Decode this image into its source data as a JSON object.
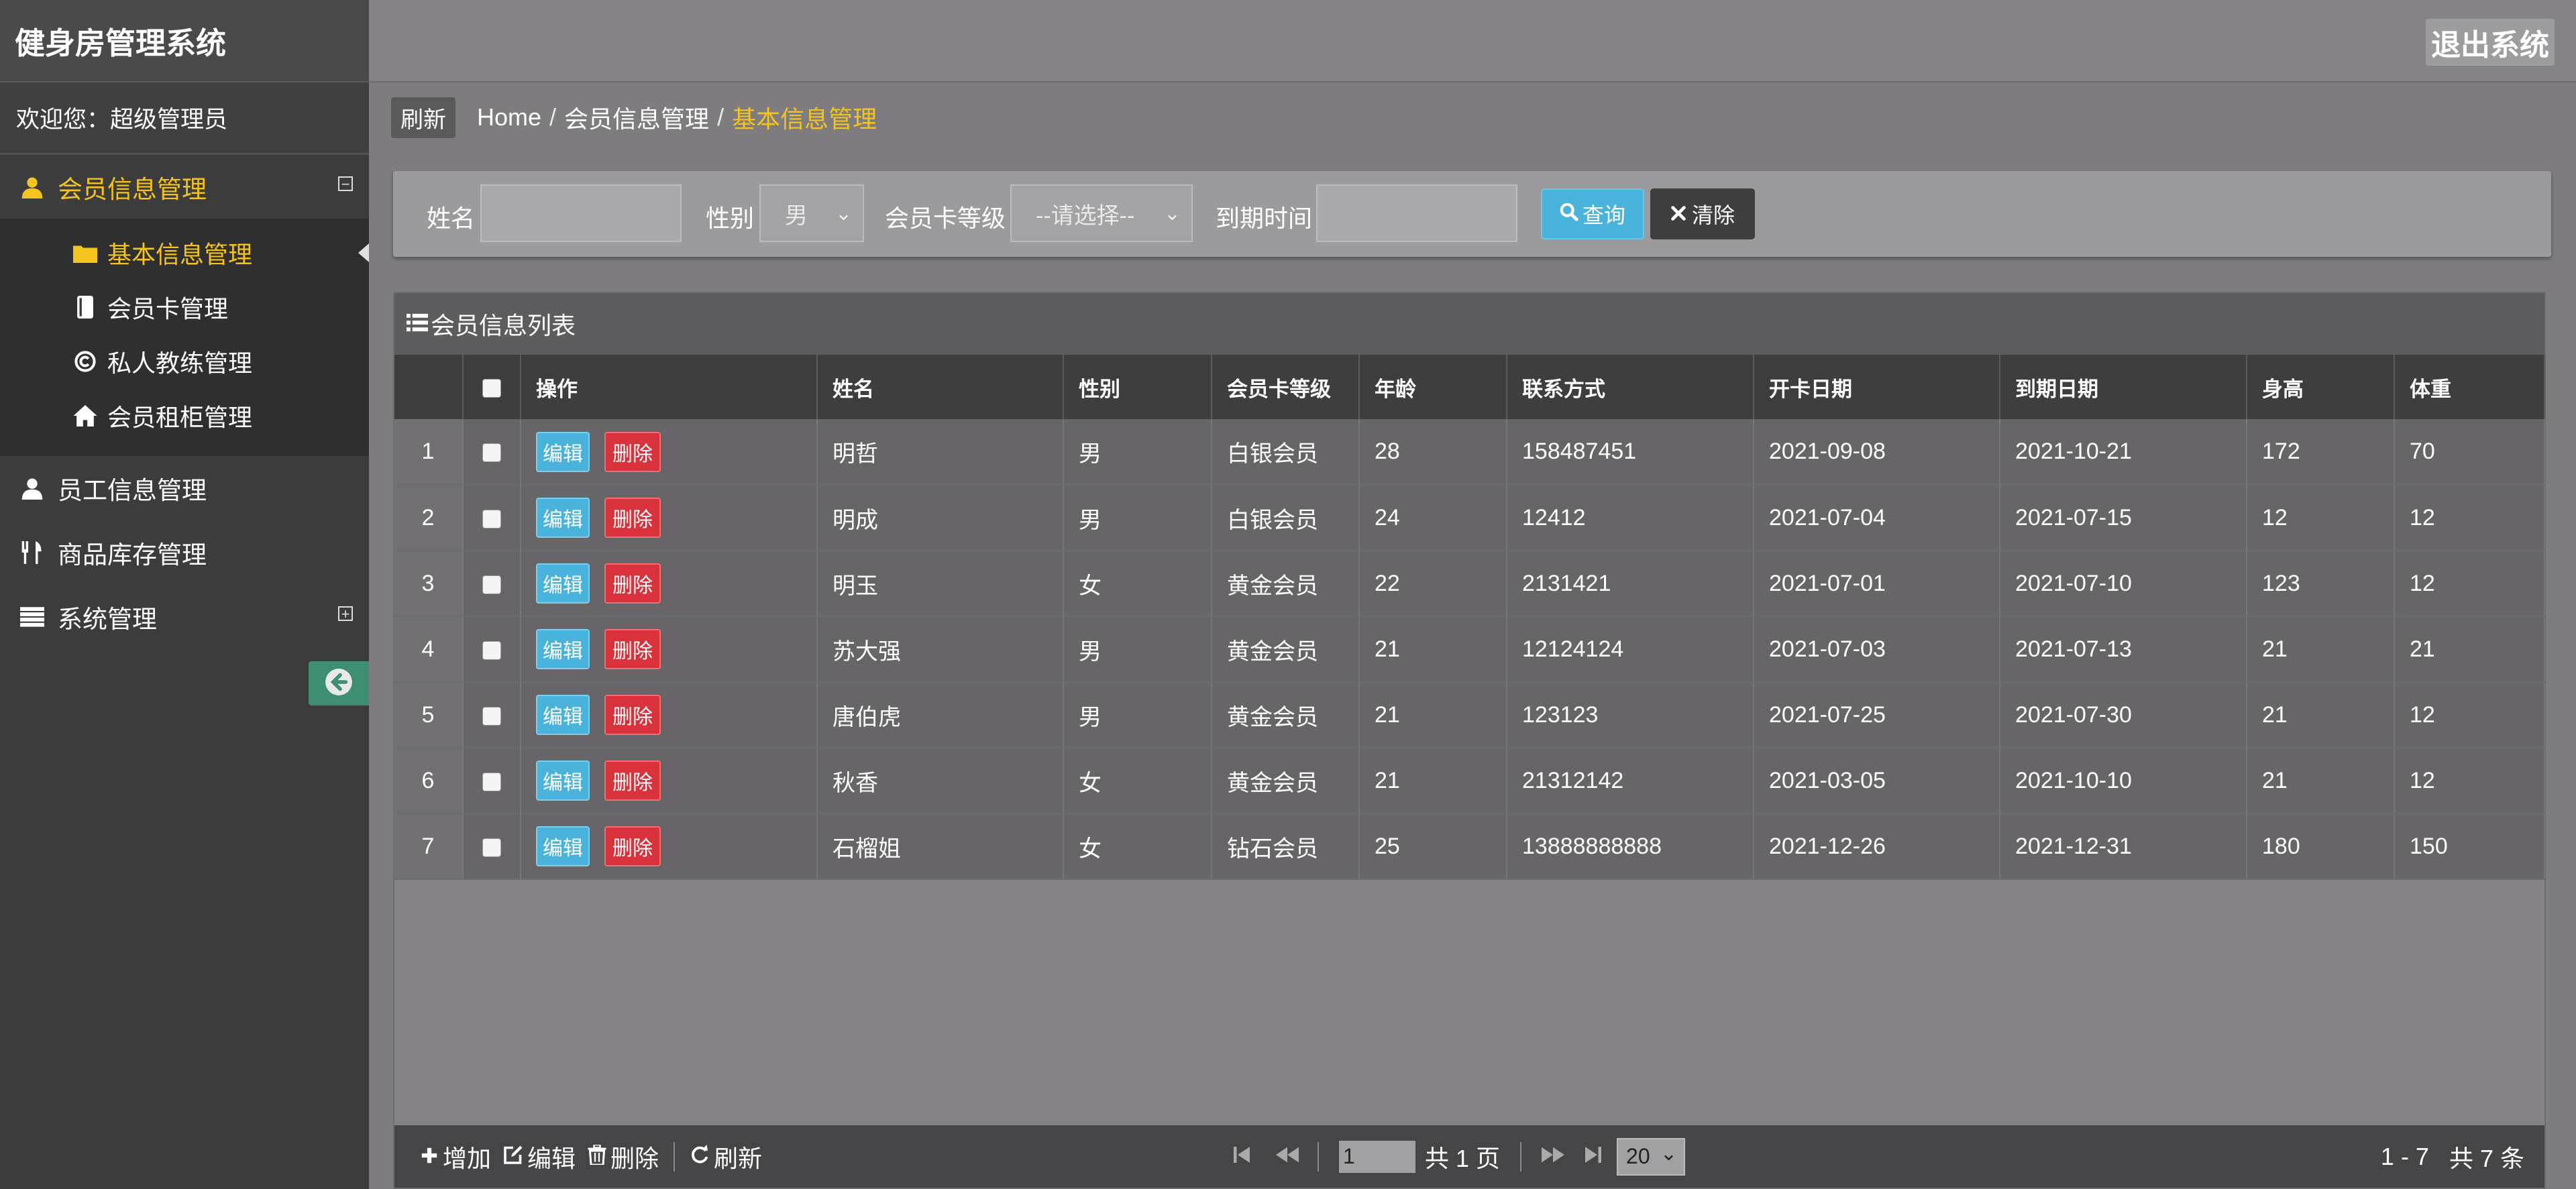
{
  "app": {
    "title": "健身房管理系统",
    "welcome": "欢迎您：超级管理员",
    "logout_label": "退出系统"
  },
  "sidebar": {
    "groups": [
      {
        "label": "会员信息管理",
        "icon": "user-icon",
        "expanded": true,
        "items": [
          {
            "label": "基本信息管理",
            "icon": "folder-icon",
            "active": true
          },
          {
            "label": "会员卡管理",
            "icon": "book-icon"
          },
          {
            "label": "私人教练管理",
            "icon": "copyright-icon"
          },
          {
            "label": "会员租柜管理",
            "icon": "home-icon"
          }
        ]
      },
      {
        "label": "员工信息管理",
        "icon": "user-icon"
      },
      {
        "label": "商品库存管理",
        "icon": "cutlery-icon"
      },
      {
        "label": "系统管理",
        "icon": "list-icon"
      }
    ]
  },
  "breadcrumb": {
    "refresh_label": "刷新",
    "items": [
      "Home",
      "会员信息管理",
      "基本信息管理"
    ],
    "sep": "/"
  },
  "search": {
    "name_label": "姓名",
    "name_value": "",
    "gender_label": "性别",
    "gender_value": "男",
    "level_label": "会员卡等级",
    "level_value": "--请选择--",
    "expire_label": "到期时间",
    "expire_value": "",
    "query_label": "查询",
    "clear_label": "清除"
  },
  "list": {
    "title": "会员信息列表",
    "headers": {
      "op": "操作",
      "name": "姓名",
      "gender": "性别",
      "level": "会员卡等级",
      "age": "年龄",
      "phone": "联系方式",
      "start": "开卡日期",
      "end": "到期日期",
      "height": "身高",
      "weight": "体重"
    },
    "edit_label": "编辑",
    "delete_label": "删除",
    "rows": [
      {
        "no": "1",
        "name": "明哲",
        "gender": "男",
        "level": "白银会员",
        "age": "28",
        "phone": "158487451",
        "start": "2021-09-08",
        "end": "2021-10-21",
        "height": "172",
        "weight": "70"
      },
      {
        "no": "2",
        "name": "明成",
        "gender": "男",
        "level": "白银会员",
        "age": "24",
        "phone": "12412",
        "start": "2021-07-04",
        "end": "2021-07-15",
        "height": "12",
        "weight": "12"
      },
      {
        "no": "3",
        "name": "明玉",
        "gender": "女",
        "level": "黄金会员",
        "age": "22",
        "phone": "2131421",
        "start": "2021-07-01",
        "end": "2021-07-10",
        "height": "123",
        "weight": "12"
      },
      {
        "no": "4",
        "name": "苏大强",
        "gender": "男",
        "level": "黄金会员",
        "age": "21",
        "phone": "12124124",
        "start": "2021-07-03",
        "end": "2021-07-13",
        "height": "21",
        "weight": "21"
      },
      {
        "no": "5",
        "name": "唐伯虎",
        "gender": "男",
        "level": "黄金会员",
        "age": "21",
        "phone": "123123",
        "start": "2021-07-25",
        "end": "2021-07-30",
        "height": "21",
        "weight": "12"
      },
      {
        "no": "6",
        "name": "秋香",
        "gender": "女",
        "level": "黄金会员",
        "age": "21",
        "phone": "21312142",
        "start": "2021-03-05",
        "end": "2021-10-10",
        "height": "21",
        "weight": "12"
      },
      {
        "no": "7",
        "name": "石榴姐",
        "gender": "女",
        "level": "钻石会员",
        "age": "25",
        "phone": "13888888888",
        "start": "2021-12-26",
        "end": "2021-12-31",
        "height": "180",
        "weight": "150"
      }
    ]
  },
  "toolbar": {
    "add_label": "增加",
    "edit_label": "编辑",
    "delete_label": "删除",
    "refresh_label": "刷新"
  },
  "pager": {
    "page_value": "1",
    "total_pages": "共 1 页",
    "page_size": "20",
    "range": "1 - 7",
    "total": "共 7 条"
  },
  "colors": {
    "accent": "#f5c31d",
    "info": "#4ab3db",
    "danger": "#d9323d",
    "sidebar": "#3c3c3c"
  }
}
